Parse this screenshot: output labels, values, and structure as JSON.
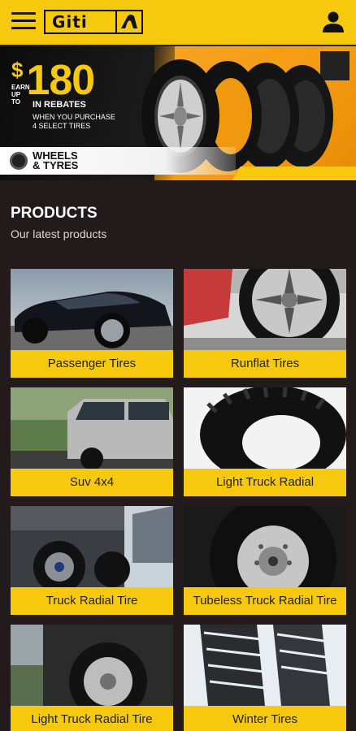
{
  "header": {
    "brand": "Giti"
  },
  "banner": {
    "dollar": "$",
    "earn_up_to": "EARN UP TO",
    "amount": "180",
    "rebates": "IN REBATES",
    "line1": "WHEN YOU PURCHASE",
    "line2": "4 SELECT TIRES",
    "brand_line1": "WHEELS",
    "brand_line2": "& TYRES"
  },
  "products": {
    "title": "PRODUCTS",
    "subtitle": "Our latest products",
    "items": [
      {
        "label": "Passenger Tires"
      },
      {
        "label": "Runflat Tires"
      },
      {
        "label": "Suv 4x4"
      },
      {
        "label": "Light Truck Radial"
      },
      {
        "label": "Truck Radial Tire"
      },
      {
        "label": "Tubeless Truck Radial Tire"
      },
      {
        "label": "Light Truck Radial Tire"
      },
      {
        "label": "Winter Tires"
      }
    ]
  },
  "colors": {
    "accent": "#f6c90e",
    "background": "#231a1b"
  }
}
